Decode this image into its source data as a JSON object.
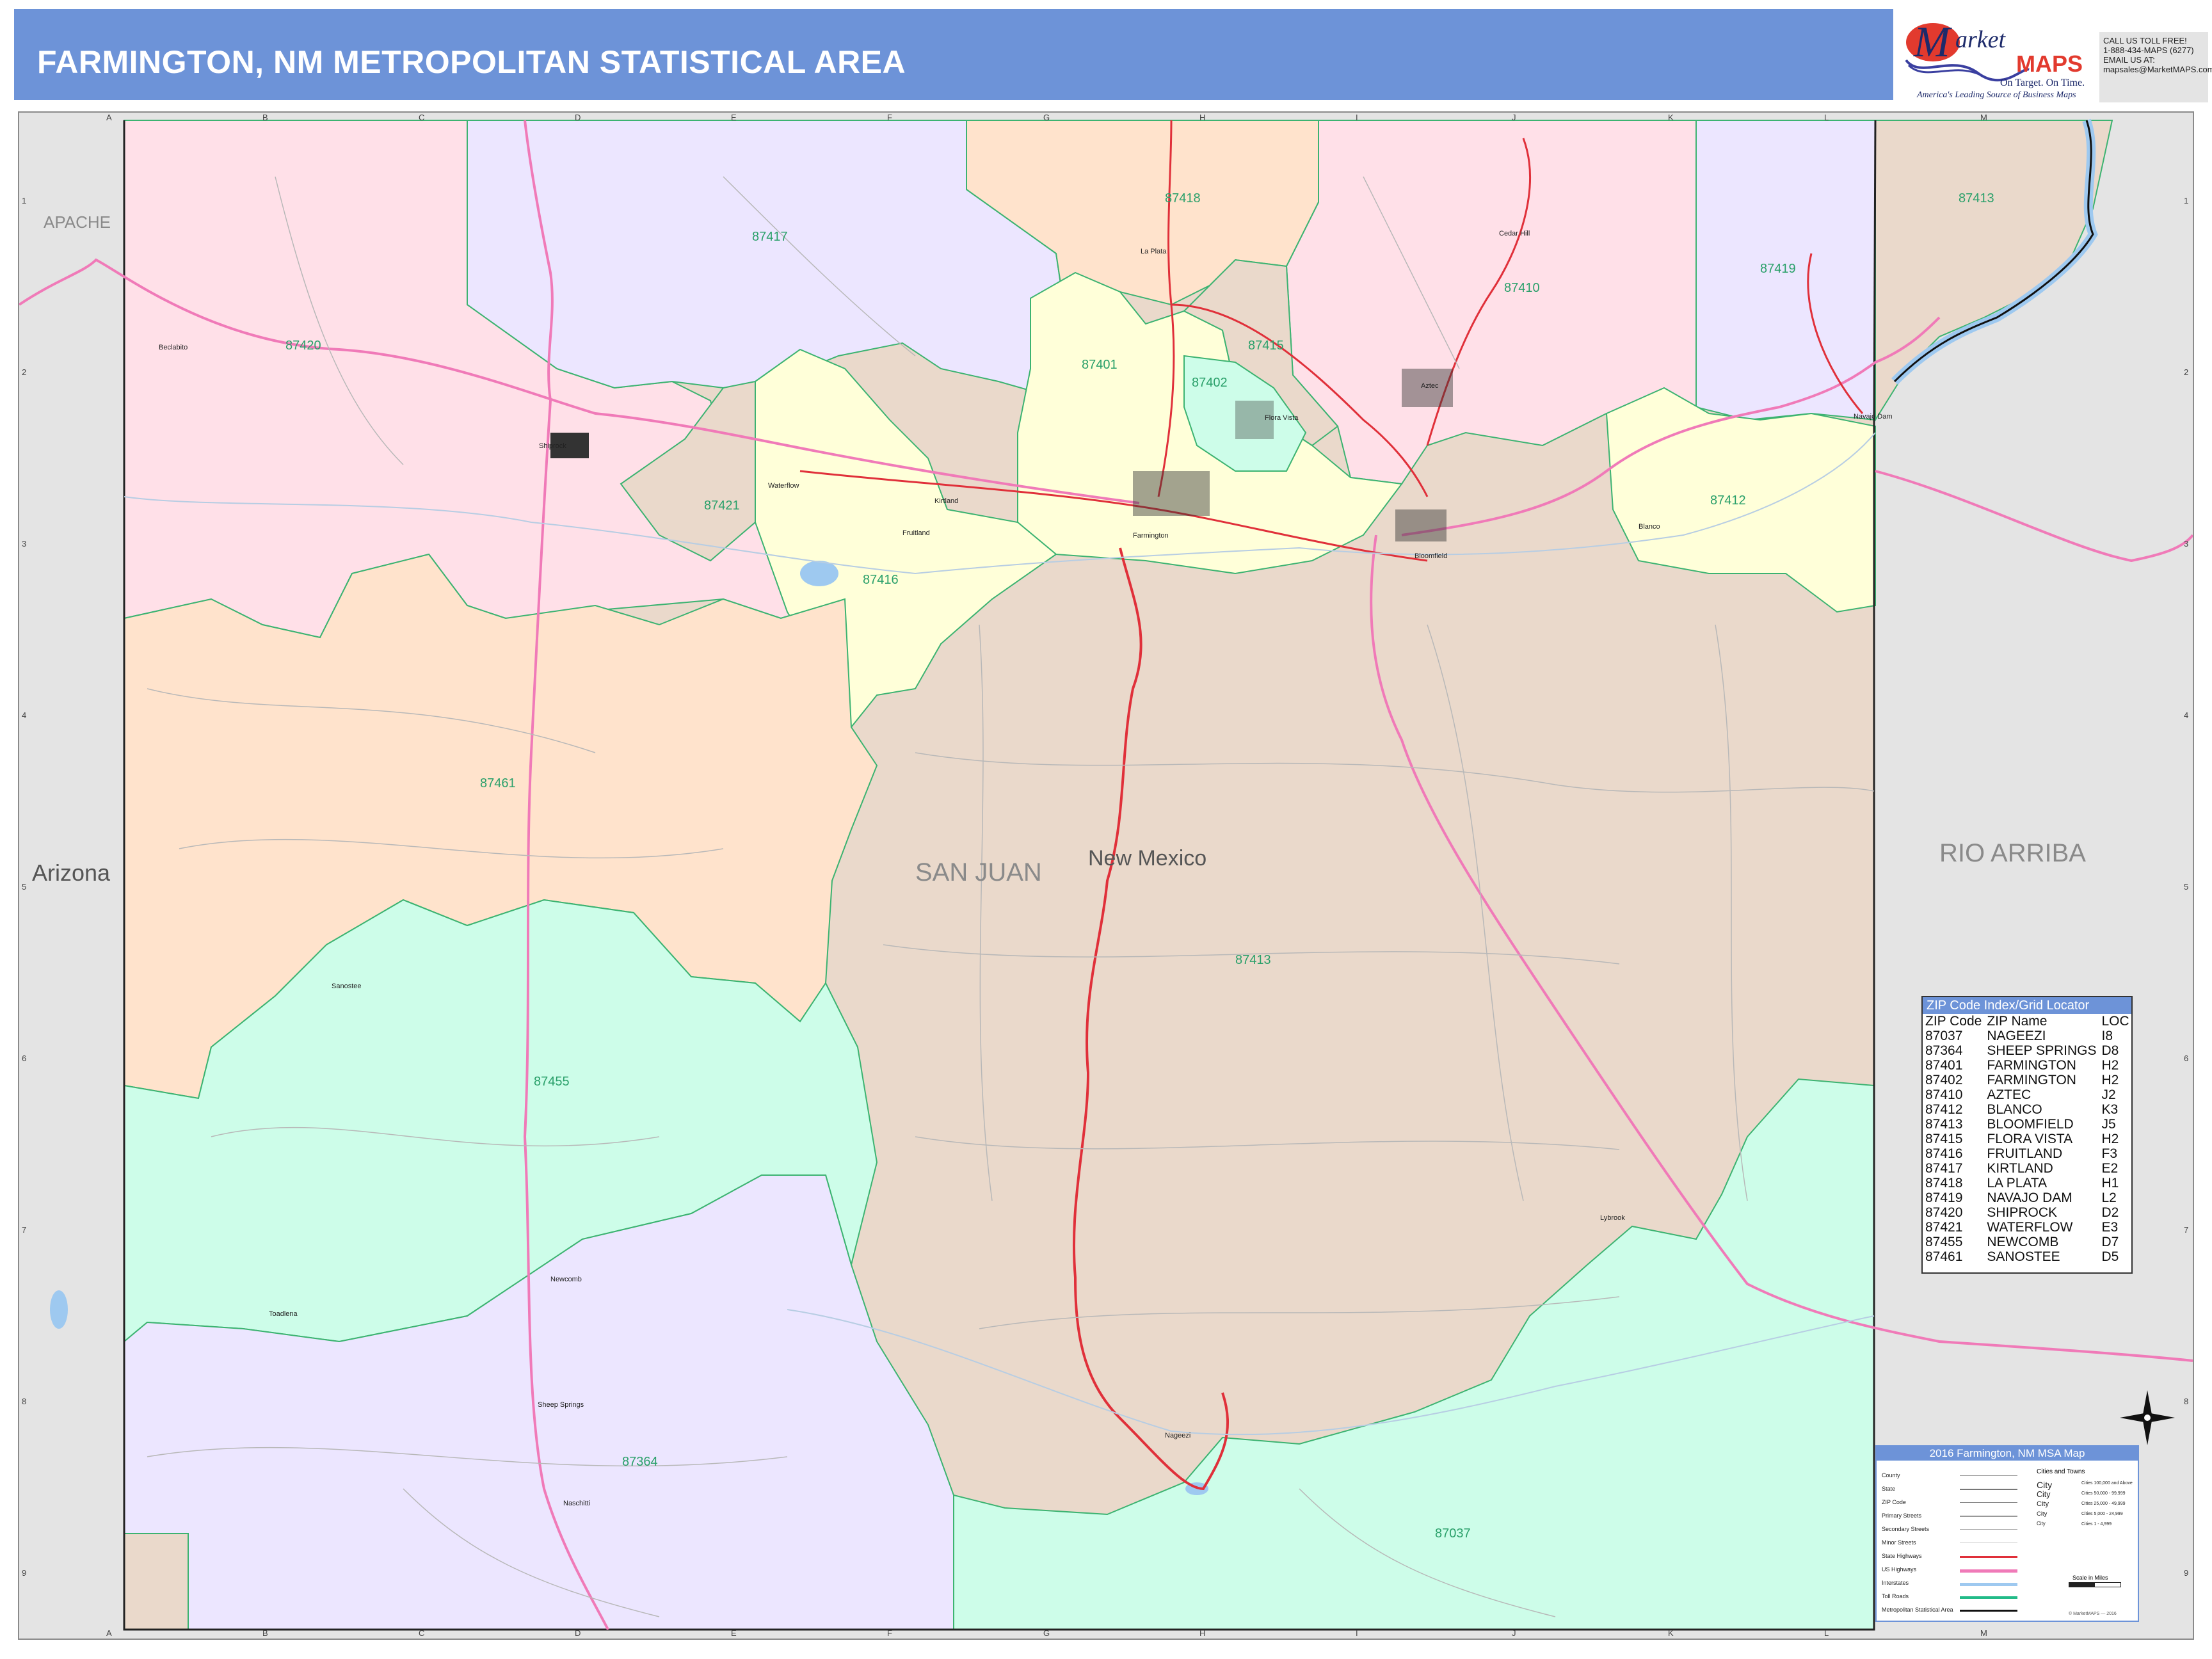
{
  "title": "FARMINGTON, NM METROPOLITAN STATISTICAL AREA",
  "logo": {
    "brand_top": "arket",
    "brand_letter": "M",
    "brand_bottom": "MAPS",
    "tagline": "On Target. On Time.",
    "subtagline": "America's Leading Source of Business Maps"
  },
  "contact": {
    "line1": "CALL US TOLL FREE!",
    "line2": "1-888-434-MAPS (6277)",
    "line3": "EMAIL US AT:",
    "line4": "mapsales@MarketMAPS.com"
  },
  "grid": {
    "columns": [
      "A",
      "B",
      "C",
      "D",
      "E",
      "F",
      "G",
      "H",
      "I",
      "J",
      "K",
      "L",
      "M"
    ],
    "rows": [
      "1",
      "2",
      "3",
      "4",
      "5",
      "6",
      "7",
      "8",
      "9"
    ]
  },
  "regions": {
    "apache": "APACHE",
    "arizona": "Arizona",
    "san_juan": "SAN JUAN",
    "new_mexico": "New Mexico",
    "rio_arriba": "RIO ARRIBA"
  },
  "zip_labels": [
    "87413",
    "87417",
    "87418",
    "87419",
    "87410",
    "87420",
    "87415",
    "87401",
    "87402",
    "87421",
    "87412",
    "87416",
    "87461",
    "87413",
    "87455",
    "87364",
    "87037"
  ],
  "town_labels": [
    "Beclabito",
    "Shiprock",
    "Waterflow",
    "Fruitland",
    "Kirtland",
    "Farmington",
    "La Plata",
    "Flora Vista",
    "Aztec",
    "Cedar Hill",
    "Bloomfield",
    "Blanco",
    "Navajo Dam",
    "Sanostee",
    "Newcomb",
    "Toadlena",
    "Sheep Springs",
    "Naschitti",
    "Nageezi",
    "Lybrook"
  ],
  "zip_index": {
    "title": "ZIP Code Index/Grid Locator",
    "headers": [
      "ZIP Code",
      "ZIP Name",
      "LOC"
    ],
    "rows": [
      [
        "87037",
        "NAGEEZI",
        "I8"
      ],
      [
        "87364",
        "SHEEP SPRINGS",
        "D8"
      ],
      [
        "87401",
        "FARMINGTON",
        "H2"
      ],
      [
        "87402",
        "FARMINGTON",
        "H2"
      ],
      [
        "87410",
        "AZTEC",
        "J2"
      ],
      [
        "87412",
        "BLANCO",
        "K3"
      ],
      [
        "87413",
        "BLOOMFIELD",
        "J5"
      ],
      [
        "87415",
        "FLORA VISTA",
        "H2"
      ],
      [
        "87416",
        "FRUITLAND",
        "F3"
      ],
      [
        "87417",
        "KIRTLAND",
        "E2"
      ],
      [
        "87418",
        "LA PLATA",
        "H1"
      ],
      [
        "87419",
        "NAVAJO DAM",
        "L2"
      ],
      [
        "87420",
        "SHIPROCK",
        "D2"
      ],
      [
        "87421",
        "WATERFLOW",
        "E3"
      ],
      [
        "87455",
        "NEWCOMB",
        "D7"
      ],
      [
        "87461",
        "SANOSTEE",
        "D5"
      ]
    ]
  },
  "legend": {
    "title": "2016 Farmington, NM MSA Map",
    "items": [
      "County",
      "State",
      "ZIP Code",
      "Primary Streets",
      "Secondary Streets",
      "Minor Streets",
      "State Highways",
      "US Highways",
      "Interstates",
      "Toll Roads",
      "Metropolitan Statistical Area"
    ],
    "cities_title": "Cities and Towns",
    "cities": [
      [
        "City",
        "Cities 100,000 and Above"
      ],
      [
        "City",
        "Cities 50,000 - 99,999"
      ],
      [
        "City",
        "Cities 25,000 - 49,999"
      ],
      [
        "City",
        "Cities 5,000 - 24,999"
      ],
      [
        "City",
        "Cities 1 - 4,999"
      ]
    ],
    "scale": "Scale in Miles",
    "copyright": "© MarketMAPS — 2016"
  },
  "colors": {
    "title_bar": "#6d93d8",
    "outside_area": "#e4e4e4",
    "pink": "#ffe0e8",
    "lavender": "#ece6ff",
    "peach": "#ffe3cc",
    "yellow": "#ffffd9",
    "tan": "#ead9cb",
    "mint": "#cdfde9",
    "zip_border": "#3cb371",
    "state_highway": "#e0303a",
    "us_highway": "#f07ab8",
    "water": "#9ec9f0"
  }
}
